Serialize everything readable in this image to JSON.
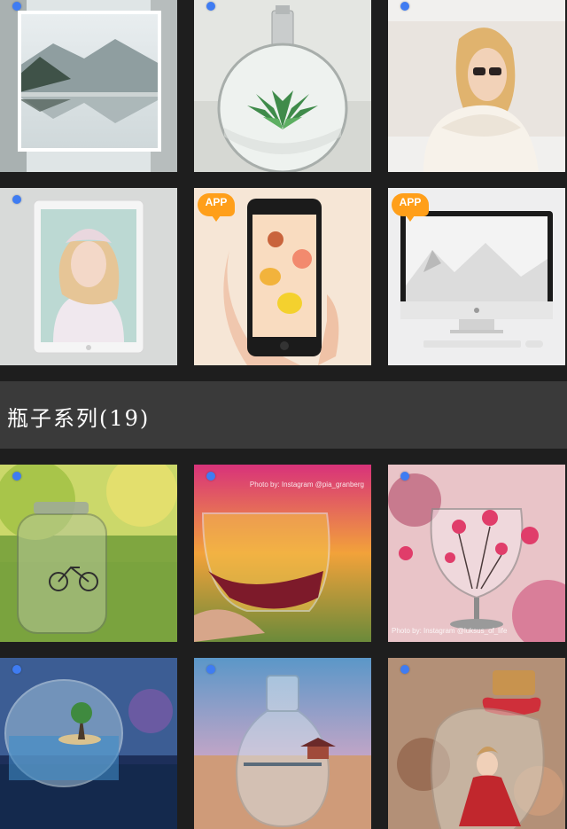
{
  "app_badge_label": "APP",
  "section_top": {
    "tiles": [
      {
        "name": "mountain-lake-frame",
        "selected_dot": true,
        "app_badge": false
      },
      {
        "name": "perfume-bottle-succulent",
        "selected_dot": true,
        "app_badge": false
      },
      {
        "name": "woman-sunglasses-scarf",
        "selected_dot": true,
        "app_badge": false
      },
      {
        "name": "ipad-portrait",
        "selected_dot": true,
        "app_badge": false
      },
      {
        "name": "phone-fruit-hand",
        "selected_dot": false,
        "app_badge": true
      },
      {
        "name": "imac-snow-mountain",
        "selected_dot": false,
        "app_badge": true
      }
    ]
  },
  "section_bottle": {
    "title": "瓶子系列(19)",
    "tiles": [
      {
        "name": "jar-bicycle",
        "selected_dot": true,
        "credit": ""
      },
      {
        "name": "wine-glass-sunset",
        "selected_dot": true,
        "credit": "Photo by: Instagram @pia_granberg"
      },
      {
        "name": "wine-glass-flowers",
        "selected_dot": true,
        "credit": "Photo by: Instagram @luksus_of_life"
      },
      {
        "name": "fishbowl-island",
        "selected_dot": true,
        "credit": ""
      },
      {
        "name": "bottle-pavilion-lake",
        "selected_dot": true,
        "credit": ""
      },
      {
        "name": "jar-girl-red-dress",
        "selected_dot": true,
        "credit": ""
      }
    ]
  },
  "colors": {
    "background": "#1e1e1e",
    "header_bar": "#3a3a3a",
    "selection_dot": "#3f7cf2",
    "app_badge": "#ff9f1a"
  }
}
